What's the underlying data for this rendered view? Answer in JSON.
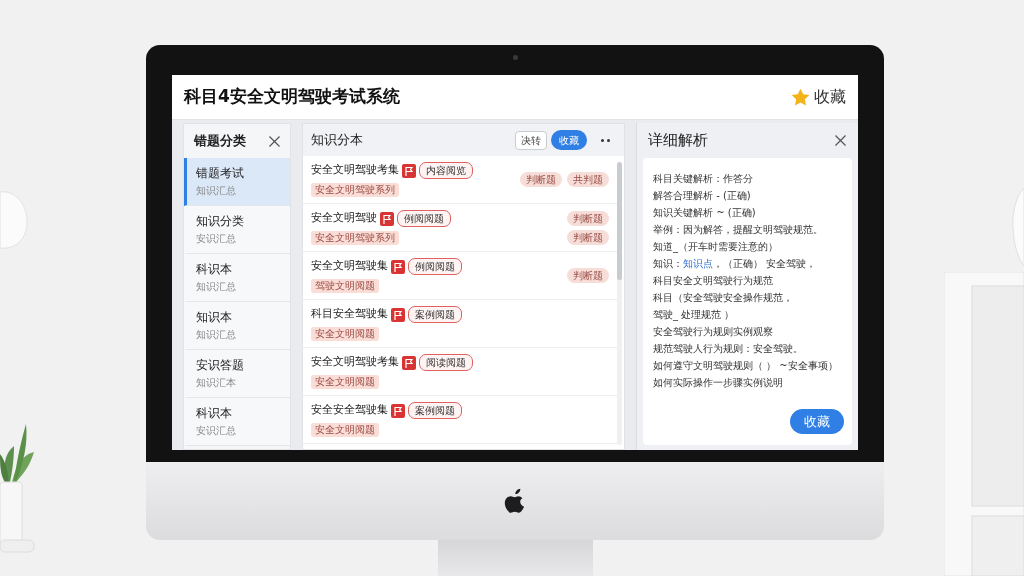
{
  "window": {
    "title": "科目4安全文明驾驶考试系统",
    "favorite_label": "收藏"
  },
  "sidebar": {
    "title": "错题分类",
    "items": [
      {
        "title": "错题考试",
        "subtitle": "知识汇总",
        "selected": true
      },
      {
        "title": "知识分类",
        "subtitle": "安识汇总",
        "selected": false
      },
      {
        "title": "科识本",
        "subtitle": "知识汇总",
        "selected": false
      },
      {
        "title": "知识本",
        "subtitle": "知识汇总",
        "selected": false
      },
      {
        "title": "安识答题",
        "subtitle": "知识汇本",
        "selected": false
      },
      {
        "title": "科识本",
        "subtitle": "安识汇总",
        "selected": false
      }
    ]
  },
  "list": {
    "title": "知识分本",
    "buttons": [
      {
        "label": "决转",
        "kind": "outline"
      },
      {
        "label": "收藏",
        "kind": "primary"
      }
    ],
    "rows": [
      {
        "title": "安全文明驾驶考集",
        "tag": "内容阅览",
        "subtag": "安全文明驾驶系列",
        "chips": [
          "判断题",
          "共判题"
        ],
        "chips_stacked": false
      },
      {
        "title": "安全文明驾驶",
        "tag": "例阅阅题",
        "subtag": "安全文明驾驶系列",
        "chips": [
          "判断题",
          "判断题"
        ],
        "chips_stacked": true
      },
      {
        "title": "安全文明驾驶集",
        "tag": "例阅阅题",
        "subtag": "驾驶文明阅题",
        "chips": [
          "判断题"
        ]
      },
      {
        "title": "科目安全驾驶集",
        "tag": "案例阅题",
        "subtag": "安全文明阅题"
      },
      {
        "title": "安全文明驾驶考集",
        "tag": "阅读阅题",
        "subtag": "安全文明阅题"
      },
      {
        "title": "安全安全驾驶集",
        "tag": "案例阅题",
        "subtag": "安全文明阅题"
      }
    ]
  },
  "detail": {
    "title": "详细解析",
    "lines": [
      {
        "text": "科目关键解析：作答分"
      },
      {
        "text": "解答合理解析 - (正确)"
      },
      {
        "text": "知识关键解析 ~ (正确)"
      },
      {
        "text": "举例：因为解答，提醒文明驾驶规范。"
      },
      {
        "text": "知道_（开车时需要注意的）"
      },
      {
        "text": "知识：",
        "link": "知识点",
        "after": "，（正确） 安全驾驶，"
      },
      {
        "text": "科目安全文明驾驶行为规范"
      },
      {
        "text": "科目（安全驾驶安全操作规范，"
      },
      {
        "text": "驾驶_ 处理规范 ）"
      },
      {
        "text": "安全驾驶行为规则实例观察"
      },
      {
        "text": "规范驾驶人行为规则：安全驾驶。"
      },
      {
        "text": "如何遵守文明驾驶规则（ ）  ~安全事项）"
      },
      {
        "text": "如何实际操作一步骤实例说明"
      }
    ],
    "button": "收藏"
  }
}
